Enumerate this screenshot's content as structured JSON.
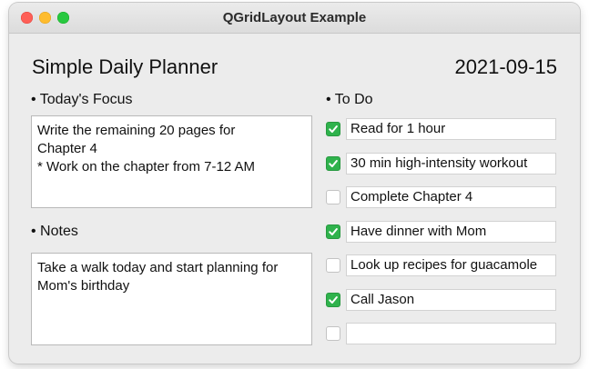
{
  "window": {
    "title": "QGridLayout Example"
  },
  "planner": {
    "heading": "Simple Daily Planner",
    "date": "2021-09-15"
  },
  "focus": {
    "label": "• Today's Focus",
    "text": "Write the remaining 20 pages for\nChapter 4\n* Work on the chapter from 7-12 AM"
  },
  "notes": {
    "label": "• Notes",
    "text": "Take a walk today and start planning for\nMom's birthday"
  },
  "todo": {
    "label": "• To Do",
    "items": [
      {
        "text": "Read for 1 hour",
        "checked": true
      },
      {
        "text": "30 min high-intensity workout",
        "checked": true
      },
      {
        "text": "Complete Chapter 4",
        "checked": false
      },
      {
        "text": "Have dinner with Mom",
        "checked": true
      },
      {
        "text": "Look up recipes for guacamole",
        "checked": false
      },
      {
        "text": "Call Jason",
        "checked": true
      },
      {
        "text": "",
        "checked": false
      }
    ]
  },
  "colors": {
    "checked_green": "#2fb24c",
    "window_bg": "#ececec"
  }
}
